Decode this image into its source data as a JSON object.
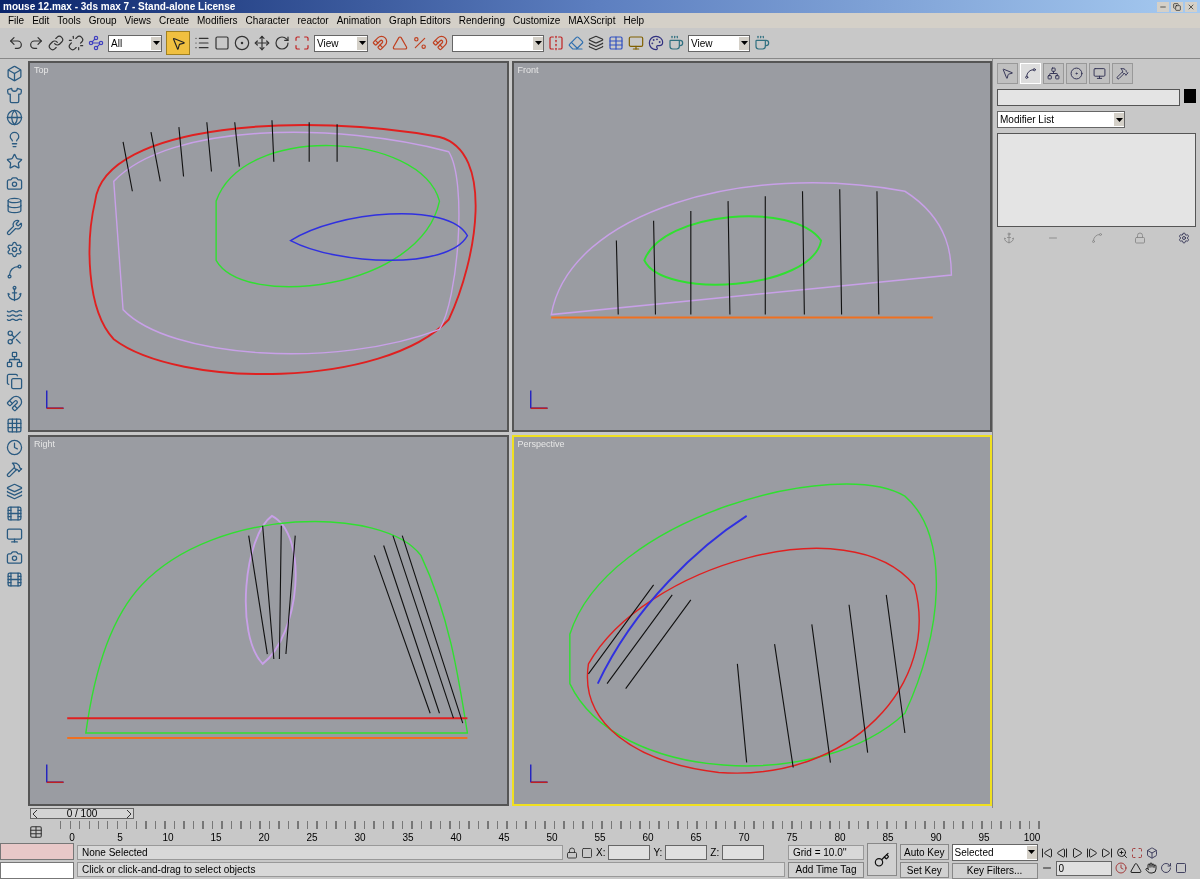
{
  "window": {
    "title": "mouse 12.max - 3ds max 7  - Stand-alone License"
  },
  "menu": [
    "File",
    "Edit",
    "Tools",
    "Group",
    "Views",
    "Create",
    "Modifiers",
    "Character",
    "reactor",
    "Animation",
    "Graph Editors",
    "Rendering",
    "Customize",
    "MAXScript",
    "Help"
  ],
  "toolbar": {
    "selection_filter": "All",
    "select_tool": {
      "selected": true
    },
    "reference_coordinates": "View",
    "render_type": "View"
  },
  "viewports": [
    {
      "label": "Top",
      "active": false
    },
    {
      "label": "Front",
      "active": false
    },
    {
      "label": "Right",
      "active": false
    },
    {
      "label": "Perspective",
      "active": true
    }
  ],
  "command_panel": {
    "tabs": [
      {
        "selected": false
      },
      {
        "selected": true
      },
      {
        "selected": false
      },
      {
        "selected": false
      },
      {
        "selected": false
      },
      {
        "selected": false
      }
    ],
    "modifier_list": "Modifier List"
  },
  "time_slider": {
    "label": "0 / 100"
  },
  "ruler": {
    "labels": [
      "0",
      "5",
      "10",
      "15",
      "20",
      "25",
      "30",
      "35",
      "40",
      "45",
      "50",
      "55",
      "60",
      "65",
      "70",
      "75",
      "80",
      "85",
      "90",
      "95",
      "100"
    ]
  },
  "status": {
    "selection": "None Selected",
    "prompt": "Click or click-and-drag to select objects",
    "coords": [
      "X:",
      "Y:",
      "Z:"
    ],
    "grid": "Grid = 10.0''",
    "time_tag": "Add Time Tag",
    "auto_key": "Auto Key",
    "set_key": "Set Key",
    "key_mode": "Selected",
    "key_filters": "Key Filters...",
    "frame": "0"
  }
}
